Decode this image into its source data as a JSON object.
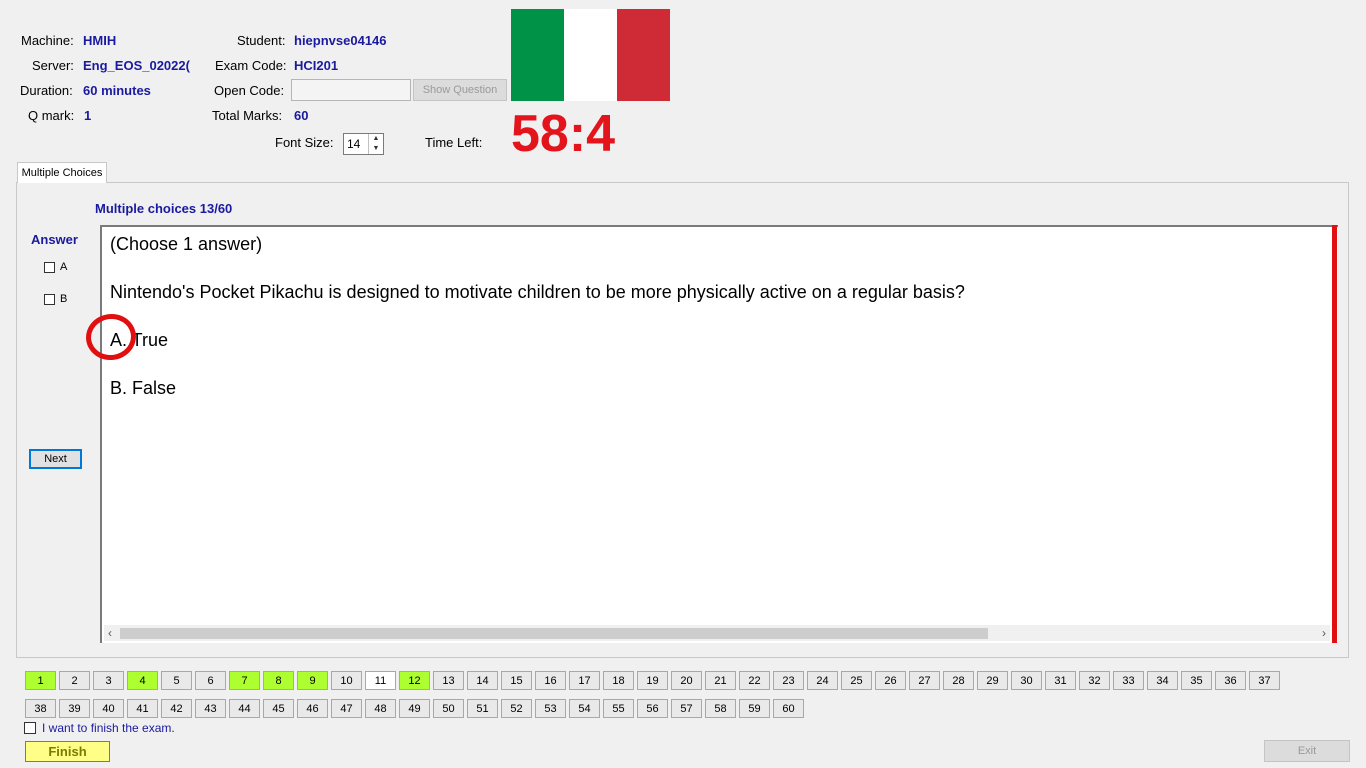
{
  "header": {
    "machine_label": "Machine:",
    "machine_value": "HMIH",
    "server_label": "Server:",
    "server_value": "Eng_EOS_02022(",
    "duration_label": "Duration:",
    "duration_value": "60 minutes",
    "qmark_label": "Q mark:",
    "qmark_value": "1",
    "student_label": "Student:",
    "student_value": "hiepnvse04146",
    "exam_code_label": "Exam Code:",
    "exam_code_value": "HCI201",
    "open_code_label": "Open Code:",
    "open_code_value": "",
    "show_question_label": "Show Question",
    "total_marks_label": "Total Marks:",
    "total_marks_value": "60",
    "font_size_label": "Font Size:",
    "font_size_value": "14",
    "time_left_label": "Time Left:",
    "time_left_value": "58:4"
  },
  "flag": {
    "colors": [
      "#009246",
      "#ffffff",
      "#ce2b37"
    ]
  },
  "tab": {
    "label": "Multiple Choices"
  },
  "question": {
    "counter": "Multiple choices 13/60",
    "instruction": "(Choose 1 answer)",
    "text": "Nintendo's Pocket Pikachu is designed to motivate children  to be more physically active on a regular basis?",
    "option_a": "A.  True",
    "option_b": "B.  False"
  },
  "answer_panel": {
    "title": "Answer",
    "options": [
      {
        "label": "A",
        "checked": false
      },
      {
        "label": "B",
        "checked": false
      }
    ],
    "next_label": "Next"
  },
  "question_nav": {
    "row1": [
      "1",
      "2",
      "3",
      "4",
      "5",
      "6",
      "7",
      "8",
      "9",
      "10",
      "11",
      "12",
      "13",
      "14",
      "15",
      "16",
      "17",
      "18",
      "19",
      "20",
      "21",
      "22",
      "23",
      "24",
      "25",
      "26",
      "27",
      "28",
      "29",
      "30",
      "31",
      "32",
      "33",
      "34",
      "35",
      "36",
      "37"
    ],
    "row2": [
      "38",
      "39",
      "40",
      "41",
      "42",
      "43",
      "44",
      "45",
      "46",
      "47",
      "48",
      "49",
      "50",
      "51",
      "52",
      "53",
      "54",
      "55",
      "56",
      "57",
      "58",
      "59",
      "60"
    ],
    "answered": [
      "1",
      "4",
      "7",
      "8",
      "9",
      "12"
    ],
    "current": "11"
  },
  "footer": {
    "finish_check_label": "I want to finish the exam.",
    "finish_label": "Finish",
    "exit_label": "Exit"
  }
}
